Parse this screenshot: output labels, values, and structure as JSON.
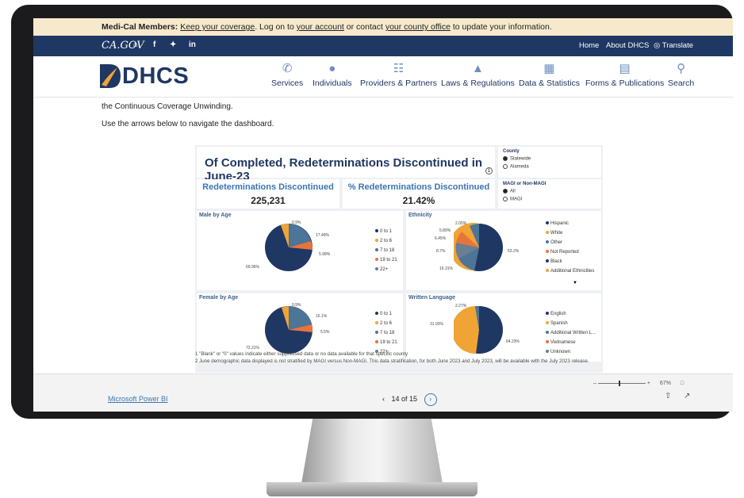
{
  "banner": {
    "bold": "Medi-Cal Members:",
    "link1": "Keep your coverage",
    "text1": ". Log on to ",
    "link2": "your account",
    "text2": " or contact ",
    "link3": "your county office",
    "text3": " to update your information."
  },
  "topnav": {
    "cagov": "CA.GOV",
    "social": [
      "home-icon",
      "facebook-icon",
      "twitter-icon",
      "linkedin-icon"
    ],
    "home": "Home",
    "about": "About DHCS",
    "translate": "Translate"
  },
  "mainnav": {
    "logo": "DHCS",
    "items": [
      {
        "label": "Services",
        "icon": "phone-icon"
      },
      {
        "label": "Individuals",
        "icon": "chat-icon"
      },
      {
        "label": "Providers & Partners",
        "icon": "network-icon"
      },
      {
        "label": "Laws & Regulations",
        "icon": "capitol-icon"
      },
      {
        "label": "Data & Statistics",
        "icon": "bar-chart-icon"
      },
      {
        "label": "Forms & Publications",
        "icon": "document-icon"
      },
      {
        "label": "Search",
        "icon": "search-icon"
      }
    ]
  },
  "intro": {
    "line1": "the Continuous Coverage Unwinding.",
    "line2": "Use the arrows below to navigate the dashboard."
  },
  "report": {
    "title": "Of Completed, Redeterminations Discontinued in June-23",
    "title_sup": "1",
    "kpi1_label": "Redeterminations Discontinued",
    "kpi1_value": "225,231",
    "kpi2_label": "% Redeterminations Discontinued",
    "kpi2_value": "21.42%",
    "county": {
      "title": "County",
      "options": [
        "Statewide",
        "Alameda"
      ],
      "selected": "Statewide"
    },
    "magi": {
      "title": "MAGI or Non-MAGI",
      "options": [
        "All",
        "MAGI"
      ],
      "selected": "All"
    }
  },
  "colors": {
    "navy": "#1f3763",
    "orange": "#f0a435",
    "steel": "#4d7499",
    "coral": "#e8743b",
    "slate": "#6b7e93",
    "banner": "#f6e9cc"
  },
  "charts": [
    {
      "title": "Male by Age",
      "legend": [
        "0 to 1",
        "2 to 6",
        "7 to 18",
        "19 to 21",
        "22+"
      ],
      "slices": [
        {
          "label": "0.9%",
          "value": 0.9
        },
        {
          "label": "17.49%",
          "value": 17.49
        },
        {
          "label": "5.98%",
          "value": 5.98
        },
        {
          "label": "69.96%",
          "value": 69.96
        }
      ]
    },
    {
      "title": "Ethnicity",
      "legend": [
        "Hispanic",
        "White",
        "Other",
        "Not Reported",
        "Black",
        "Additional Ethnicities"
      ],
      "slices": [
        {
          "label": "53.2%",
          "value": 53.2
        },
        {
          "label": "16.31%",
          "value": 16.31
        },
        {
          "label": "8.7%",
          "value": 8.7
        },
        {
          "label": "6.45%",
          "value": 6.45
        },
        {
          "label": "5.89%",
          "value": 5.89
        },
        {
          "label": "2.05%",
          "value": 2.05
        }
      ]
    },
    {
      "title": "Female by Age",
      "legend": [
        "0 to 1",
        "2 to 6",
        "7 to 18",
        "19 to 21",
        "22+"
      ],
      "slices": [
        {
          "label": "0.9%",
          "value": 0.9
        },
        {
          "label": "16.1%",
          "value": 16.1
        },
        {
          "label": "5.5%",
          "value": 5.5
        },
        {
          "label": "72.21%",
          "value": 72.21
        }
      ]
    },
    {
      "title": "Written Language",
      "legend": [
        "English",
        "Spanish",
        "Additional Written L...",
        "Vietnamese",
        "Unknown"
      ],
      "slices": [
        {
          "label": "2.27%",
          "value": 2.27
        },
        {
          "label": "64.23%",
          "value": 64.23
        },
        {
          "label": "31.93%",
          "value": 31.93
        }
      ]
    }
  ],
  "footnotes": {
    "n1": "1 \"Blank\" or \"0\" values indicate either suppressed data or no data available for that specific county",
    "n2": "2 June demographic data displayed is not stratified by MAGI versus Non-MAGI. This data stratification, for both June 2023 and July 2023, will be available with the July 2023 release."
  },
  "pbi": {
    "brand": "Microsoft Power BI",
    "page": "14 of 15",
    "zoom": "67%"
  }
}
